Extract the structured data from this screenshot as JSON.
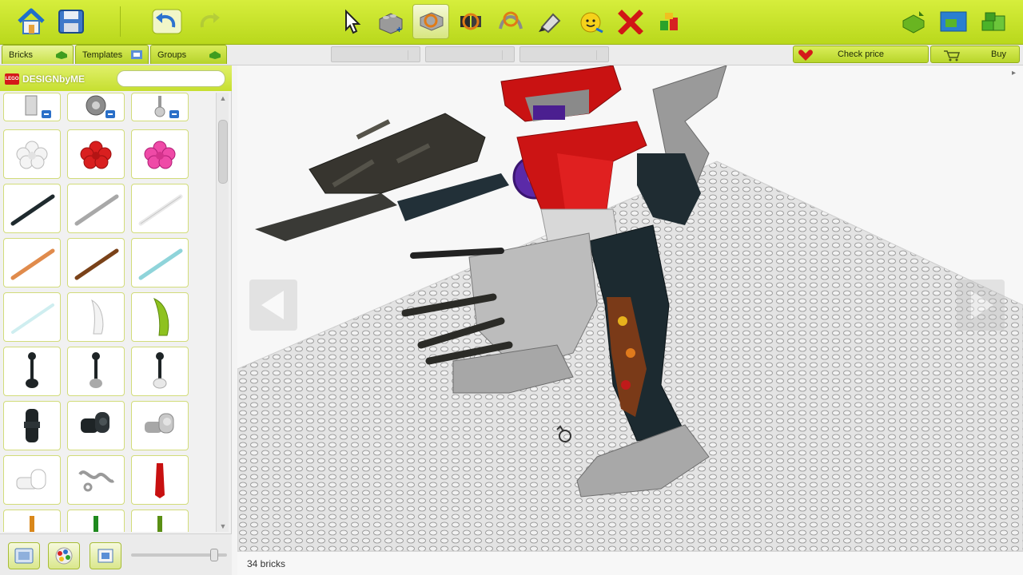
{
  "toolbar": {
    "buttons": [
      {
        "name": "home-button",
        "icon": "house-icon",
        "selected": false
      },
      {
        "name": "save-button",
        "icon": "floppy-disk-icon",
        "selected": false
      },
      {
        "name": "undo-button",
        "icon": "undo-arrow-icon",
        "selected": false
      },
      {
        "name": "redo-button",
        "icon": "redo-arrow-icon",
        "selected": false
      },
      {
        "name": "select-tool-button",
        "icon": "cursor-arrow-icon",
        "selected": false
      },
      {
        "name": "clone-tool-button",
        "icon": "clone-brick-icon",
        "selected": false
      },
      {
        "name": "hinge-tool-button",
        "icon": "hinge-icon",
        "selected": true
      },
      {
        "name": "hinge-align-tool-button",
        "icon": "hinge-align-icon",
        "selected": false
      },
      {
        "name": "flex-tool-button",
        "icon": "flex-element-icon",
        "selected": false
      },
      {
        "name": "paint-tool-button",
        "icon": "paint-bucket-icon",
        "selected": false
      },
      {
        "name": "decorate-tool-button",
        "icon": "minifig-head-icon",
        "selected": false
      },
      {
        "name": "delete-tool-button",
        "icon": "red-x-icon",
        "selected": false
      },
      {
        "name": "hide-tool-button",
        "icon": "colored-bricks-icon",
        "selected": false
      },
      {
        "name": "build-mode-button",
        "icon": "green-brick-arrow-icon",
        "selected": false
      },
      {
        "name": "view-mode-button",
        "icon": "box-scene-icon",
        "selected": false
      },
      {
        "name": "building-guide-button",
        "icon": "green-bricks-stack-icon",
        "selected": false
      }
    ]
  },
  "tabs": [
    {
      "label": "Bricks",
      "icon": "green-brick-icon",
      "active": true
    },
    {
      "label": "Templates",
      "icon": "templates-icon",
      "active": false
    },
    {
      "label": "Groups",
      "icon": "green-brick-icon",
      "active": false
    }
  ],
  "price": {
    "check_label": "Check price",
    "buy_label": "Buy",
    "check_icon": "heart-tag-icon",
    "buy_icon": "cart-icon"
  },
  "panel": {
    "logo_badge": "LEGO",
    "logo_text": "DESIGNbyME",
    "search_value": "",
    "search_placeholder": "",
    "category_icons": [
      "door-frame-icon",
      "wheel-icon",
      "minifig-accessory-icon"
    ],
    "bricks": [
      "white-flower-brick",
      "red-flower-brick",
      "pink-flower-brick",
      "black-bar-brick",
      "gray-bar-brick",
      "white-bar-brick",
      "orange-bar-brick",
      "brown-bar-brick",
      "light-blue-bar-brick",
      "transparent-bar-brick",
      "white-horn-brick",
      "lime-horn-brick",
      "black-ball-joint-brick",
      "black-ball-joint-brick-2",
      "black-ball-joint-brick-3",
      "black-axle-connector-brick",
      "black-cross-connector-brick",
      "gray-connector-brick",
      "white-connector-brick",
      "gray-chain-brick",
      "red-blade-brick",
      "orange-stick-brick",
      "green-stick-brick",
      "green-stick-brick-2"
    ]
  },
  "bottom_bar": {
    "buttons": [
      "view-mode-icon",
      "color-palette-icon",
      "brick-filter-icon"
    ],
    "zoom_level": 0.9
  },
  "status": {
    "brick_count": "34 bricks"
  },
  "colors": {
    "toolbar": "#c6e12b",
    "accent_red": "#d41a1a"
  }
}
